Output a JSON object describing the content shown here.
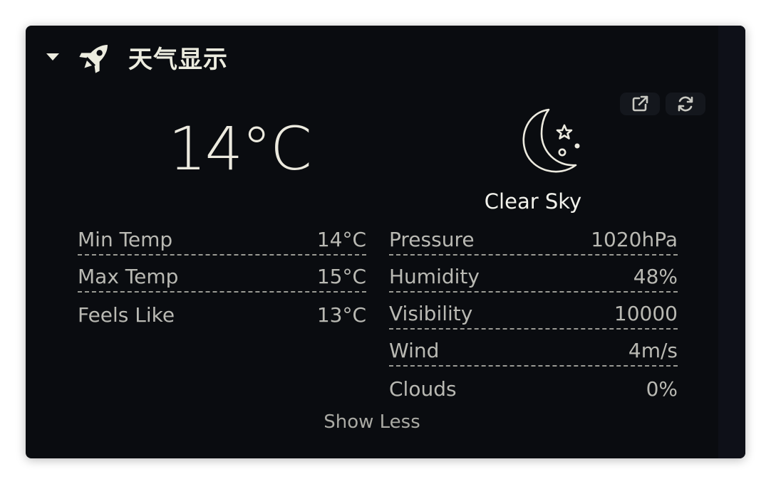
{
  "widget": {
    "title": "天气显示",
    "icons": {
      "collapse": "caret-down-icon",
      "header": "rocket-icon",
      "external": "external-link-icon",
      "refresh": "refresh-icon",
      "weather": "moon-stars-icon"
    }
  },
  "current": {
    "temperature": "14°C",
    "description": "Clear Sky"
  },
  "stats_left": [
    {
      "label": "Min Temp",
      "value": "14°C"
    },
    {
      "label": "Max Temp",
      "value": "15°C"
    },
    {
      "label": "Feels Like",
      "value": "13°C"
    }
  ],
  "stats_right": [
    {
      "label": "Pressure",
      "value": "1020hPa"
    },
    {
      "label": "Humidity",
      "value": "48%"
    },
    {
      "label": "Visibility",
      "value": "10000"
    },
    {
      "label": "Wind",
      "value": "4m/s"
    },
    {
      "label": "Clouds",
      "value": "0%"
    }
  ],
  "toggle_label": "Show Less",
  "colors": {
    "card_bg": "#0a0c10",
    "text_primary": "#eceadf",
    "text_secondary": "#b9b9b3"
  }
}
